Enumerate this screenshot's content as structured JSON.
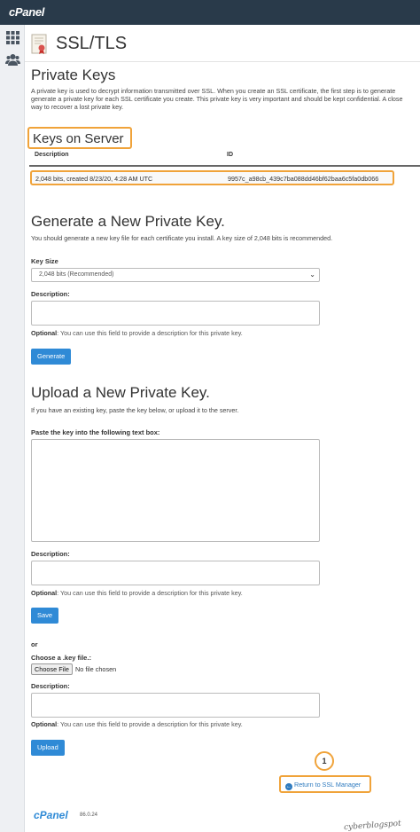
{
  "app": {
    "logo_text": "cPanel",
    "version": "86.0.24"
  },
  "sidebar": {
    "icons": [
      "grid-icon",
      "users-icon"
    ]
  },
  "page": {
    "title": "SSL/TLS",
    "icon": "certificate-icon"
  },
  "private_keys": {
    "heading": "Private Keys",
    "description_lines": [
      "A private key is used to decrypt information transmitted over SSL. When you create an SSL certificate, the first step is to generate",
      "generate a private key for each SSL certificate you create. This private key is very important and should be kept confidential. A close",
      "way to recover a lost private key."
    ]
  },
  "keys_on_server": {
    "heading": "Keys on Server",
    "columns": [
      "Description",
      "ID"
    ],
    "rows": [
      {
        "description": "2,048 bits, created 8/23/20, 4:28 AM UTC",
        "id": "9957c_a98cb_439c7ba088dd46bf62baa6c5fa0db066"
      }
    ]
  },
  "generate": {
    "heading": "Generate a New Private Key.",
    "intro": "You should generate a new key file for each certificate you install. A key size of 2,048 bits is recommended.",
    "key_size_label": "Key Size",
    "key_size_selected": "2,048 bits (Recommended)",
    "description_label": "Description:",
    "help_bold": "Optional",
    "help_text": ": You can use this field to provide a description for this private key.",
    "button": "Generate"
  },
  "upload": {
    "heading": "Upload a New Private Key.",
    "intro": "If you have an existing key, paste the key below, or upload it to the server.",
    "paste_label": "Paste the key into the following text box:",
    "description_label": "Description:",
    "help_bold": "Optional",
    "help_text": ": You can use this field to provide a description for this private key.",
    "save_button": "Save",
    "or_text": "or",
    "choose_label": "Choose a .key file.:",
    "choose_button": "Choose File",
    "no_file": "No file chosen",
    "description2_label": "Description:",
    "help2_bold": "Optional",
    "help2_text": ": You can use this field to provide a description for this private key.",
    "upload_button": "Upload"
  },
  "annotation": {
    "step_number": "1",
    "highlight_color": "#f0a33a"
  },
  "return_link": {
    "label": "Return to SSL Manager",
    "icon": "arrow-left-circle-icon"
  },
  "watermark": "cyberblogspot"
}
